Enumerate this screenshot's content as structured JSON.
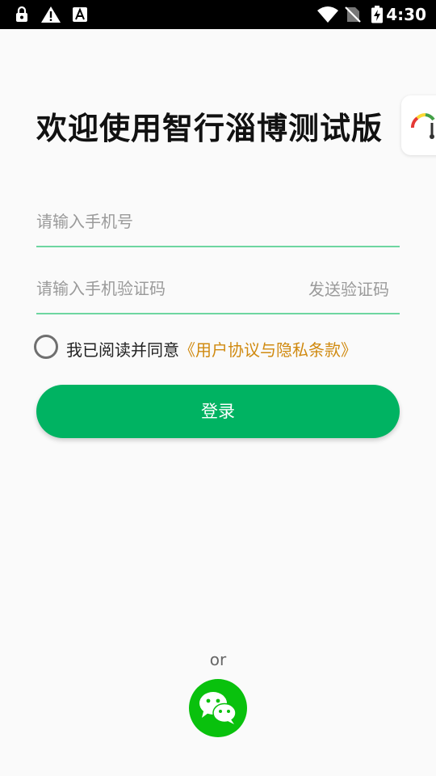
{
  "status_bar": {
    "time": "4:30",
    "icons": [
      "lock-icon",
      "warning-icon",
      "font-icon",
      "wifi-icon",
      "no-sim-icon",
      "battery-charging-icon"
    ]
  },
  "title": "欢迎使用智行淄博测试版",
  "phone_input": {
    "placeholder": "请输入手机号",
    "value": ""
  },
  "code_input": {
    "placeholder": "请输入手机验证码",
    "value": ""
  },
  "send_code_label": "发送验证码",
  "agreement": {
    "prefix": "我已阅读并同意",
    "link": "《用户协议与隐私条款》",
    "checked": false
  },
  "login_label": "登录",
  "or_label": "or",
  "colors": {
    "primary": "#00b362",
    "wechat": "#09c10d",
    "link": "#d08a10",
    "underline": "#6ed6a0"
  }
}
